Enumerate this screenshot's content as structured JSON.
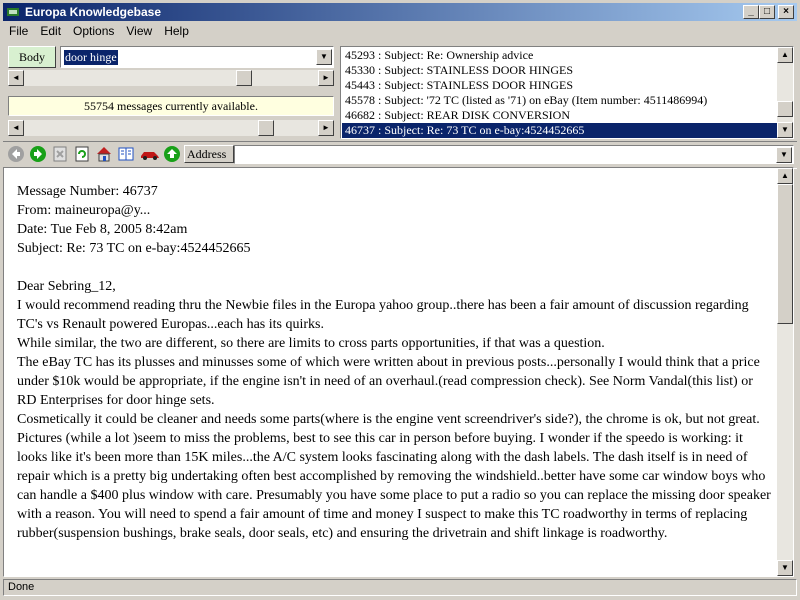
{
  "window": {
    "title": "Europa Knowledgebase"
  },
  "menu": [
    "File",
    "Edit",
    "Options",
    "View",
    "Help"
  ],
  "search": {
    "field_button": "Body",
    "query": "door hinge"
  },
  "status_info": "55754 messages currently available.",
  "results": [
    "45293 : Subject: Re: Ownership advice",
    "45330 : Subject: STAINLESS DOOR HINGES",
    "45443 : Subject: STAINLESS DOOR HINGES",
    "45578 : Subject: '72 TC (listed as '71) on eBay (Item number: 4511486994)",
    "46682 : Subject: REAR DISK CONVERSION",
    "46737 : Subject: Re: 73 TC on e-bay:4524452665"
  ],
  "selected_result_index": 5,
  "toolbar": {
    "address_label": "Address",
    "address_value": "",
    "icons": [
      "back-arrow-icon",
      "forward-arrow-icon",
      "stop-icon",
      "refresh-icon",
      "home-icon",
      "book-icon",
      "car-icon",
      "up-arrow-icon"
    ]
  },
  "message": {
    "header": [
      "Message Number: 46737",
      "From: maineuropa@y...",
      "Date: Tue Feb 8, 2005 8:42am",
      "Subject: Re: 73 TC on e-bay:4524452665"
    ],
    "greeting": "Dear Sebring_12,",
    "body": [
      "I would recommend reading thru the Newbie files in the Europa yahoo group..there has been a fair amount of discussion regarding TC's vs Renault powered Europas...each has its quirks.",
      "While similar, the two are different, so there are limits to cross parts opportunities, if that was a question.",
      "The eBay TC has its plusses and minusses some of which were written about in previous posts...personally I would think that a price under $10k would be appropriate, if the engine isn't in need of an overhaul.(read compression check). See Norm Vandal(this list) or RD Enterprises for door hinge sets.",
      "Cosmetically it could be cleaner and needs some parts(where is the engine vent screendriver's side?), the chrome is ok, but not great. Pictures (while a lot )seem to miss the problems, best to see this car in person before buying. I wonder if the speedo is working: it looks like it's been more than 15K miles...the A/C system looks fascinating along with the dash labels. The dash itself is in need of repair which is a pretty big undertaking often best accomplished by removing the windshield..better have some car window boys who can handle a $400 plus window with care. Presumably you have some place to put a radio so you can replace the missing door speaker with a reason. You will need to spend a fair amount of time and money I suspect to make this TC roadworthy in terms of replacing rubber(suspension bushings, brake seals, door seals, etc) and ensuring the drivetrain and shift linkage is roadworthy."
    ]
  },
  "statusbar": {
    "text": "Done"
  }
}
